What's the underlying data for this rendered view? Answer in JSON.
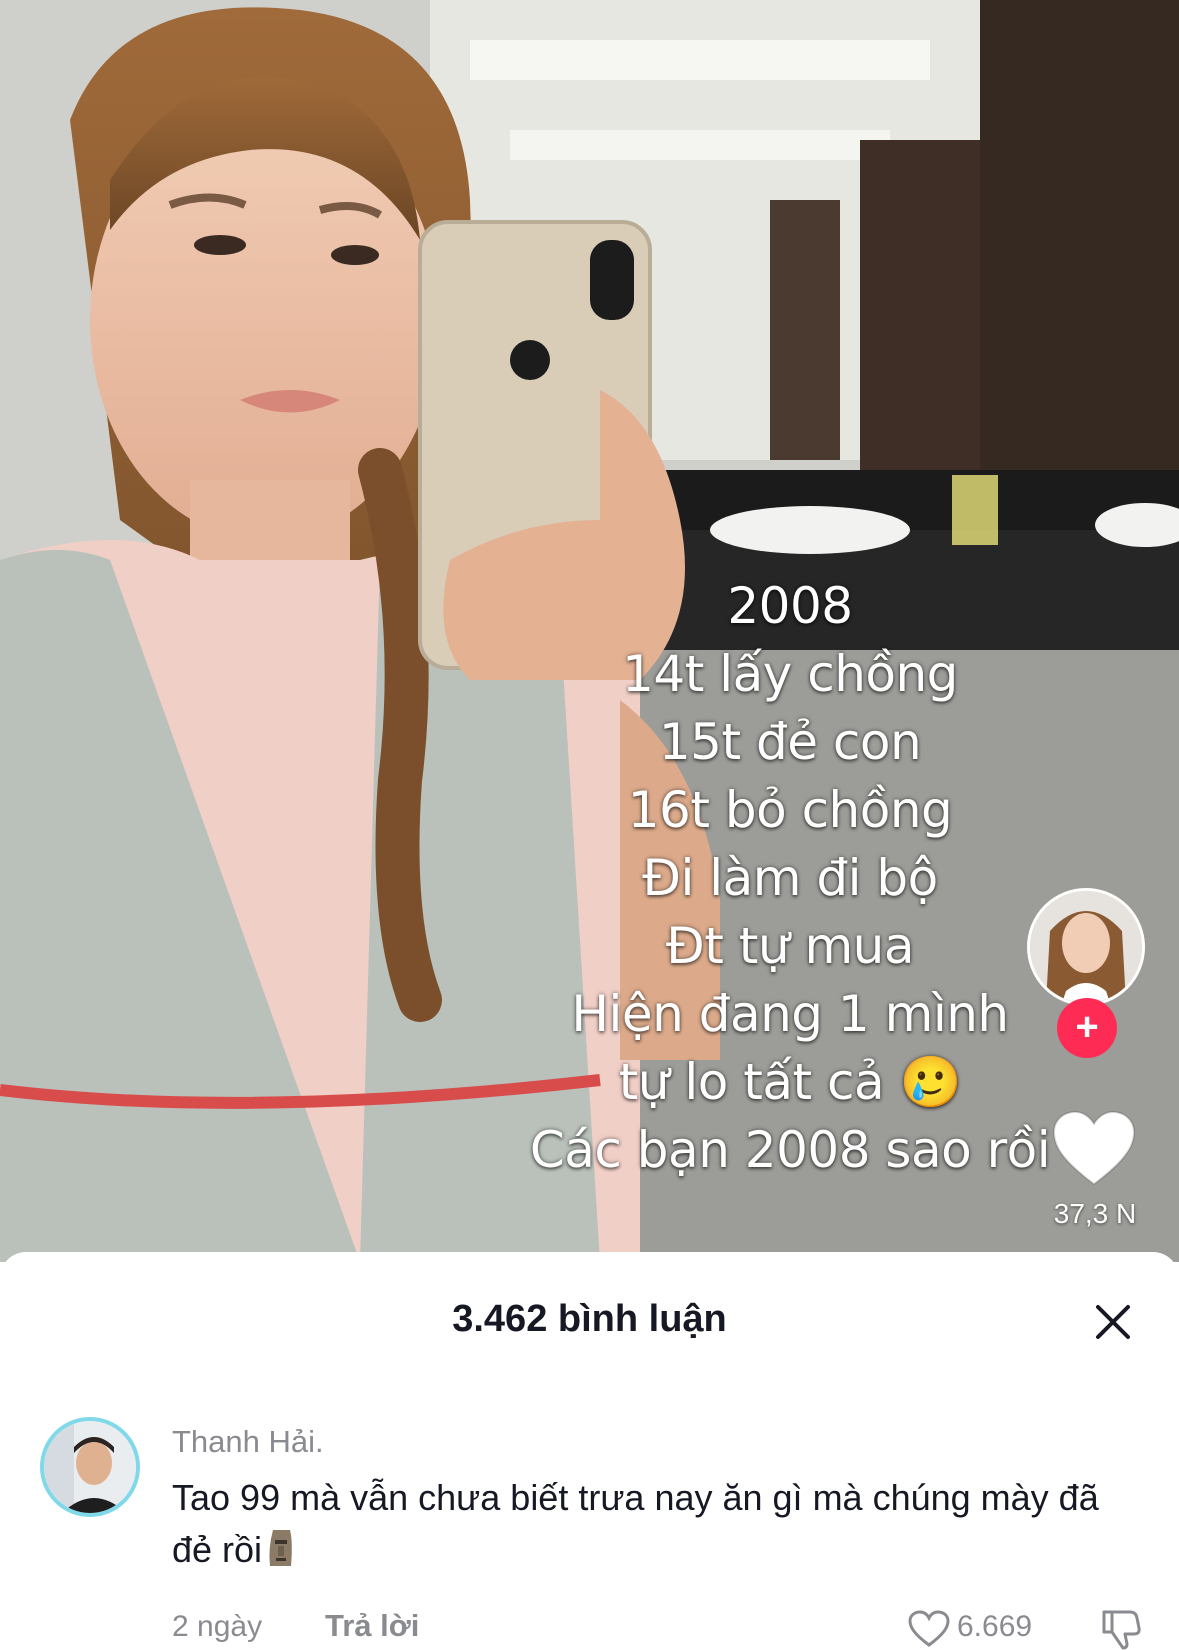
{
  "video": {
    "overlay_lines": [
      "2008",
      "14t lấy chồng",
      "15t đẻ con",
      "16t bỏ chồng",
      "Đi làm đi bộ",
      "Đt tự mua",
      "Hiện đang  1 mình",
      "tự lo tất cả 🥲",
      "Các bạn 2008 sao rồi"
    ],
    "like_count": "37,3 N",
    "icons": {
      "follow": "plus-icon",
      "like": "heart-icon"
    }
  },
  "comments": {
    "title": "3.462 bình luận",
    "close_icon": "close-icon",
    "items": [
      {
        "username": "Thanh Hải.",
        "text": "Tao 99 mà vẫn chưa biết trưa nay ăn gì mà chúng mày đã đẻ rồi",
        "emoji": "moai-icon",
        "time": "2 ngày",
        "reply_label": "Trả lời",
        "like_count": "6.669"
      }
    ]
  },
  "colors": {
    "accent": "#fe2c55",
    "text_primary": "#161823",
    "text_secondary": "#8a8b91",
    "avatar_ring": "#7fd9e8"
  }
}
